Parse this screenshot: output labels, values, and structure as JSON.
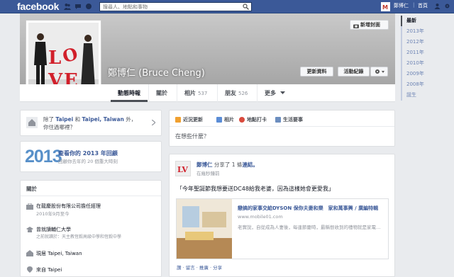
{
  "topbar": {
    "logo": "facebook",
    "search_placeholder": "搜尋人、地點和事物",
    "user_name": "鄭博仁",
    "home": "首頁"
  },
  "cover": {
    "add_cover": "新增封面"
  },
  "profile": {
    "name": "鄭博仁 (Bruce Cheng)",
    "update_info": "更新資料",
    "activity_log": "活動紀錄"
  },
  "nav": [
    {
      "label": "動態時報",
      "count": ""
    },
    {
      "label": "關於",
      "count": ""
    },
    {
      "label": "相片",
      "count": "537"
    },
    {
      "label": "朋友",
      "count": "526"
    },
    {
      "label": "更多",
      "count": ""
    }
  ],
  "timeline": [
    "最新",
    "2013年",
    "2012年",
    "2011年",
    "2010年",
    "2009年",
    "2008年",
    "誕生"
  ],
  "location_card": {
    "text_pre": "除了 ",
    "city1": "Taipei",
    "mid": " 和 ",
    "city2": "Taipei, Taiwan",
    "text_post": " 外，",
    "line2": "你住過哪裡？"
  },
  "year_card": {
    "year": "2013",
    "title": "查看你的 2013 年回顧",
    "sub": "回顧你去年的 20 個重大時刻"
  },
  "about": {
    "header": "關於",
    "items": [
      {
        "title": "在龍慶股份有限公司擔任經理",
        "sub": "2010年9月至今"
      },
      {
        "title": "曾就讀輔仁大學",
        "sub": "之前就讀於：天主教恆毅高級中學和恆毅中學"
      },
      {
        "title": "現居 Taipei, Taiwan",
        "sub": ""
      },
      {
        "title": "來自 Taipei",
        "sub": ""
      }
    ]
  },
  "composer": {
    "tabs": [
      "近況更新",
      "相片",
      "地點打卡",
      "生活要事"
    ],
    "placeholder": "在想些什麼？"
  },
  "post": {
    "author": "鄭博仁",
    "shared": " 分享了 1 條",
    "link_word": "連結。",
    "time": "在幾秒鐘前",
    "message": "「今年聖誕節我想要送DC48給我老婆，因為這樣她會更愛我」",
    "link_title": "戀搞的家事交給DYSON 保你夫妻和樂　家和萬事興 / 廣編特輯",
    "link_url": "www.mobile01.com",
    "link_desc": "老實說，自從成為人妻後，每逢節慶時，最稱恨收到的禮物就是家電…",
    "actions": "讚 · 留言 · 推廣 · 分享"
  }
}
